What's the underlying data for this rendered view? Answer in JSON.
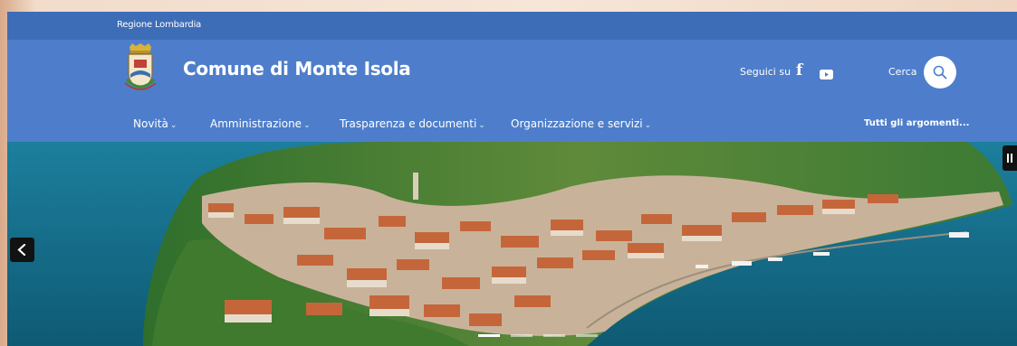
{
  "topbar": {
    "region_label": "Regione Lombardia"
  },
  "header": {
    "title": "Comune di Monte Isola",
    "follow_label": "Seguici su",
    "social_icons": [
      "facebook-icon",
      "youtube-icon"
    ],
    "search_label": "Cerca"
  },
  "nav": {
    "items": [
      {
        "label": "Novità"
      },
      {
        "label": "Amministrazione"
      },
      {
        "label": "Trasparenza e documenti"
      },
      {
        "label": "Organizzazione e servizi"
      }
    ],
    "all_topics": "Tutti gli argomenti..."
  },
  "carousel": {
    "slides": 4,
    "active_slide": 1
  },
  "colors": {
    "topbar": "#3e6db8",
    "header": "#4e7ecb",
    "lake": "#146a86",
    "roofs": "#c5663a"
  }
}
